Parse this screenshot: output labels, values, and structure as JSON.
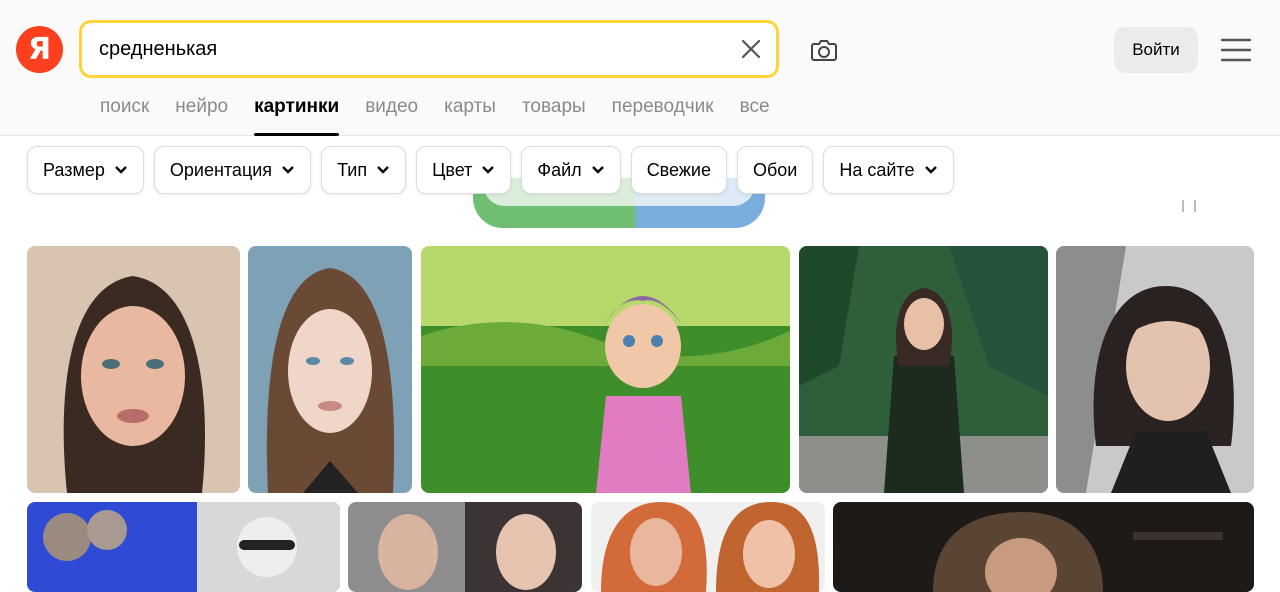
{
  "header": {
    "logo_letter": "Я",
    "search": {
      "value": "средненькая",
      "placeholder": ""
    },
    "login_label": "Войти"
  },
  "tabs": [
    {
      "label": "поиск",
      "active": false
    },
    {
      "label": "нейро",
      "active": false
    },
    {
      "label": "картинки",
      "active": true
    },
    {
      "label": "видео",
      "active": false
    },
    {
      "label": "карты",
      "active": false
    },
    {
      "label": "товары",
      "active": false
    },
    {
      "label": "переводчик",
      "active": false
    },
    {
      "label": "все",
      "active": false
    }
  ],
  "filters": [
    {
      "label": "Размер",
      "dropdown": true
    },
    {
      "label": "Ориентация",
      "dropdown": true
    },
    {
      "label": "Тип",
      "dropdown": true
    },
    {
      "label": "Цвет",
      "dropdown": true
    },
    {
      "label": "Файл",
      "dropdown": true
    },
    {
      "label": "Свежие",
      "dropdown": false
    },
    {
      "label": "Обои",
      "dropdown": false
    },
    {
      "label": "На сайте",
      "dropdown": true
    }
  ],
  "colors": {
    "logo": "#fc3f1d",
    "search_border": "#ffd43b",
    "login_bg": "#ebebeb",
    "tab_inactive": "#8a8a8a"
  },
  "results": [
    {
      "icon": "portrait-photo",
      "palette": [
        "#d9c4b2",
        "#3a2a22",
        "#e8b8a0"
      ]
    },
    {
      "icon": "portrait-photo",
      "palette": [
        "#7fa1b6",
        "#6b4a35",
        "#f0d6c8"
      ]
    },
    {
      "icon": "child-in-grass-photo",
      "palette": [
        "#b7d86a",
        "#3f8e2c",
        "#e27cc2"
      ]
    },
    {
      "icon": "woman-outdoors-photo",
      "palette": [
        "#2e5e3a",
        "#1d2a1e",
        "#3a2a26"
      ]
    },
    {
      "icon": "portrait-photo",
      "palette": [
        "#c9c9c9",
        "#2a2220",
        "#e3c2b0"
      ]
    },
    {
      "icon": "people-collage-photo",
      "palette": [
        "#2f4bd6",
        "#d8d8d8",
        "#222222"
      ]
    },
    {
      "icon": "faces-collage-photo",
      "palette": [
        "#8d8d8d",
        "#d8b3a0",
        "#3c3434"
      ]
    },
    {
      "icon": "faces-collage-photo",
      "palette": [
        "#d36a3a",
        "#e9b79d",
        "#f0f0f0"
      ]
    },
    {
      "icon": "dark-portrait-photo",
      "palette": [
        "#1e1a18",
        "#5a4434",
        "#c89a7e"
      ]
    }
  ]
}
